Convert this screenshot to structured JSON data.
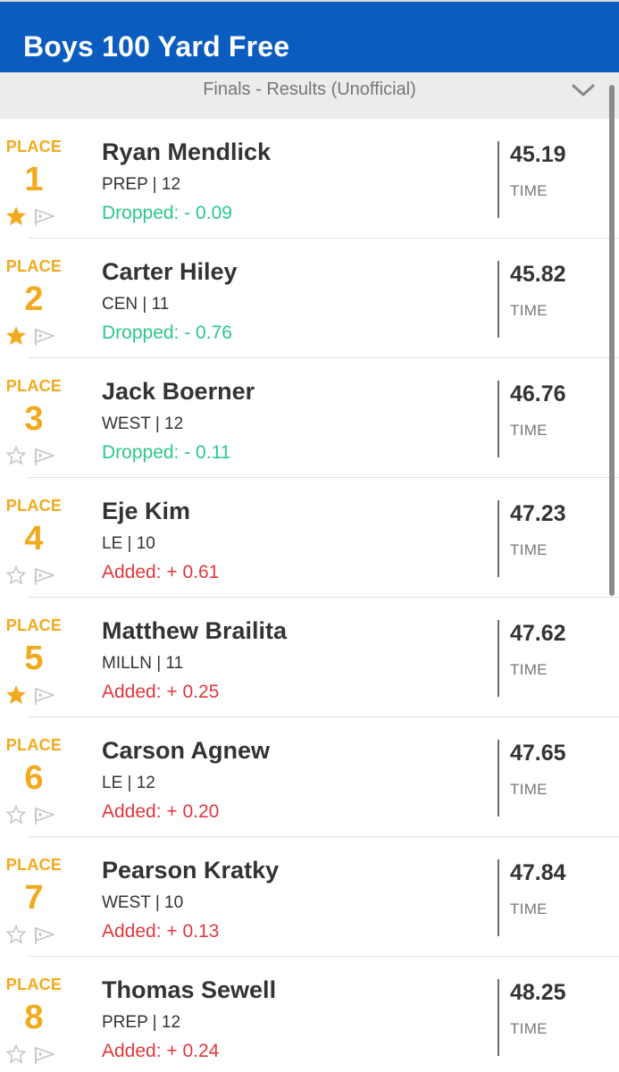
{
  "header": {
    "title": "Boys 100 Yard Free"
  },
  "subheader": {
    "label": "Finals - Results (Unofficial)",
    "dropdown_icon": "chevron-down-icon"
  },
  "colors": {
    "header_bg": "#0a5cbf",
    "place_gold": "#f3a91c",
    "dropped_green": "#2bc88a",
    "added_red": "#e0383e"
  },
  "results": [
    {
      "place_label": "PLACE",
      "place": "1",
      "name": "Ryan Mendlick",
      "team": "PREP | 12",
      "delta": "Dropped: - 0.09",
      "delta_type": "drop",
      "time": "45.19",
      "time_label": "TIME",
      "starred": true
    },
    {
      "place_label": "PLACE",
      "place": "2",
      "name": "Carter Hiley",
      "team": "CEN | 11",
      "delta": "Dropped: - 0.76",
      "delta_type": "drop",
      "time": "45.82",
      "time_label": "TIME",
      "starred": true
    },
    {
      "place_label": "PLACE",
      "place": "3",
      "name": "Jack Boerner",
      "team": "WEST | 12",
      "delta": "Dropped: - 0.11",
      "delta_type": "drop",
      "time": "46.76",
      "time_label": "TIME",
      "starred": false
    },
    {
      "place_label": "PLACE",
      "place": "4",
      "name": "Eje Kim",
      "team": "LE | 10",
      "delta": "Added: + 0.61",
      "delta_type": "add",
      "time": "47.23",
      "time_label": "TIME",
      "starred": false
    },
    {
      "place_label": "PLACE",
      "place": "5",
      "name": "Matthew Brailita",
      "team": "MILLN | 11",
      "delta": "Added: + 0.25",
      "delta_type": "add",
      "time": "47.62",
      "time_label": "TIME",
      "starred": true
    },
    {
      "place_label": "PLACE",
      "place": "6",
      "name": "Carson Agnew",
      "team": "LE | 12",
      "delta": "Added: + 0.20",
      "delta_type": "add",
      "time": "47.65",
      "time_label": "TIME",
      "starred": false
    },
    {
      "place_label": "PLACE",
      "place": "7",
      "name": "Pearson Kratky",
      "team": "WEST | 10",
      "delta": "Added: + 0.13",
      "delta_type": "add",
      "time": "47.84",
      "time_label": "TIME",
      "starred": false
    },
    {
      "place_label": "PLACE",
      "place": "8",
      "name": "Thomas Sewell",
      "team": "PREP | 12",
      "delta": "Added: + 0.24",
      "delta_type": "add",
      "time": "48.25",
      "time_label": "TIME",
      "starred": false
    }
  ]
}
